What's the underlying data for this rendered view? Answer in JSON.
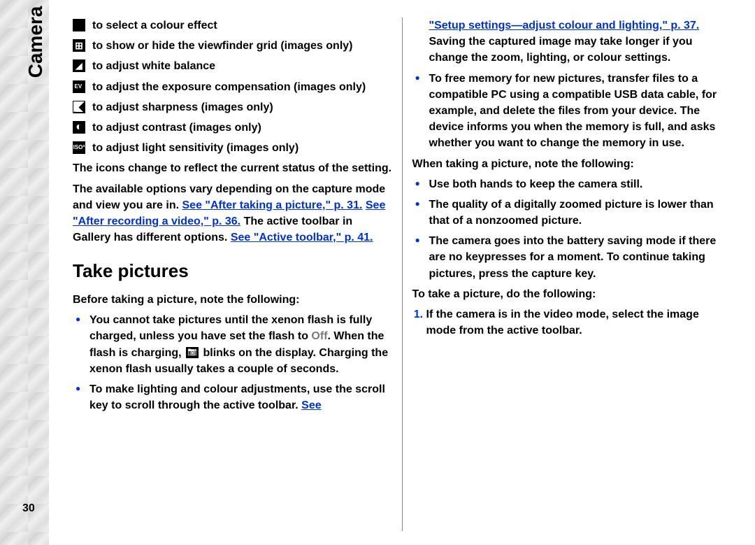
{
  "side_label": "Camera",
  "page_number": "30",
  "col1": {
    "icon_items": [
      {
        "icon": "square",
        "text": "to select a colour effect"
      },
      {
        "icon": "grid",
        "text": "to show or hide the viewfinder grid (images only)"
      },
      {
        "icon": "wb",
        "text": "to adjust white balance"
      },
      {
        "icon": "ev",
        "text": "to adjust the exposure compensation (images only)"
      },
      {
        "icon": "sharp",
        "text": "to adjust sharpness (images only)"
      },
      {
        "icon": "contrast",
        "text": "to adjust contrast (images only)"
      },
      {
        "icon": "iso",
        "text": "to adjust light sensitivity (images only)"
      }
    ],
    "para1": "The icons change to reflect the current status of the setting.",
    "para2_a": "The available options vary depending on the capture mode and view you are in. ",
    "link1": "See \"After taking a picture,\" p. 31.",
    "space1": " ",
    "link2": "See \"After recording a video,\" p. 36.",
    "para2_b": " The active toolbar in Gallery has different options. ",
    "link3": "See \"Active toolbar,\" p. 41.",
    "heading": "Take pictures",
    "para3": "Before taking a picture, note the following:",
    "bullet1_a": "You cannot take pictures until the xenon flash is fully charged, unless you have set the flash to ",
    "bullet1_off": "Off",
    "bullet1_b": ". When the flash is charging, ",
    "bullet1_c": " blinks on the display. Charging the xenon flash usually takes a couple of seconds.",
    "bullet2_a": "To make lighting and colour adjustments, use the scroll key to scroll through the active toolbar. ",
    "bullet2_link": "See"
  },
  "col2": {
    "cont_link": "\"Setup settings—adjust colour and lighting,\" p. 37.",
    "cont_text": " Saving the captured image may take longer if you change the zoom, lighting, or colour settings.",
    "bullet3": "To free memory for new pictures, transfer files to a compatible PC using a compatible USB data cable, for example, and delete the files from your device. The device informs you when the memory is full, and asks whether you want to change the memory in use.",
    "para4": "When taking a picture, note the following:",
    "bullet4": "Use both hands to keep the camera still.",
    "bullet5": "The quality of a digitally zoomed picture is lower than that of a nonzoomed picture.",
    "bullet6": "The camera goes into the battery saving mode if there are no keypresses for a moment. To continue taking pictures, press the capture key.",
    "para5": "To take a picture, do the following:",
    "step1": "If the camera is in the video mode, select the image mode from the active toolbar."
  }
}
